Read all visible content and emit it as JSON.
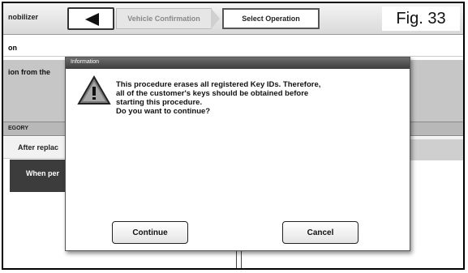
{
  "header": {
    "app_title": "nobilizer",
    "breadcrumbs": [
      "Vehicle Confirmation",
      "Select Operation"
    ],
    "back_icon": "left-triangle-icon"
  },
  "figure_label": "Fig. 33",
  "background": {
    "row_label": "on",
    "description": "ion from the",
    "category_header": "EGORY",
    "row_after": "After replac",
    "row_when": "When per"
  },
  "dialog": {
    "title": "Information",
    "icon": "warning-icon",
    "message": [
      "This procedure erases all registered Key IDs. Therefore,",
      "all of the customer's keys should be obtained before",
      "starting this procedure.",
      "Do you want to continue?"
    ],
    "continue_label": "Continue",
    "cancel_label": "Cancel"
  }
}
